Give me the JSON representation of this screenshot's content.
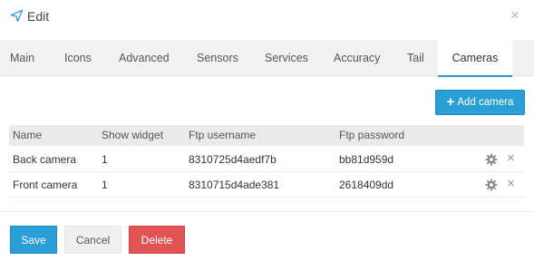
{
  "dialog": {
    "title": "Edit",
    "title_icon": "navigation-arrow-icon",
    "close_label": "×"
  },
  "tabs": [
    {
      "label": "Main",
      "active": false
    },
    {
      "label": "Icons",
      "active": false
    },
    {
      "label": "Advanced",
      "active": false
    },
    {
      "label": "Sensors",
      "active": false
    },
    {
      "label": "Services",
      "active": false
    },
    {
      "label": "Accuracy",
      "active": false
    },
    {
      "label": "Tail",
      "active": false
    },
    {
      "label": "Cameras",
      "active": true
    }
  ],
  "toolbar": {
    "add_camera_label": "Add camera",
    "add_icon": "plus-icon"
  },
  "table": {
    "columns": [
      "Name",
      "Show widget",
      "Ftp username",
      "Ftp password"
    ],
    "rows": [
      {
        "name": "Back camera",
        "show_widget": "1",
        "ftp_username": "8310725d4aedf7b",
        "ftp_password": "bb81d959d"
      },
      {
        "name": "Front camera",
        "show_widget": "1",
        "ftp_username": "8310715d4ade381",
        "ftp_password": "2618409dd"
      }
    ],
    "row_actions": {
      "settings_icon": "gear-icon",
      "delete_icon": "close-icon",
      "delete_label": "×"
    }
  },
  "footer": {
    "save_label": "Save",
    "cancel_label": "Cancel",
    "delete_label": "Delete"
  },
  "colors": {
    "accent": "#2a9fd6",
    "danger": "#e05454",
    "tab_bar": "#f2f2f2",
    "table_header": "#eaeaea"
  }
}
